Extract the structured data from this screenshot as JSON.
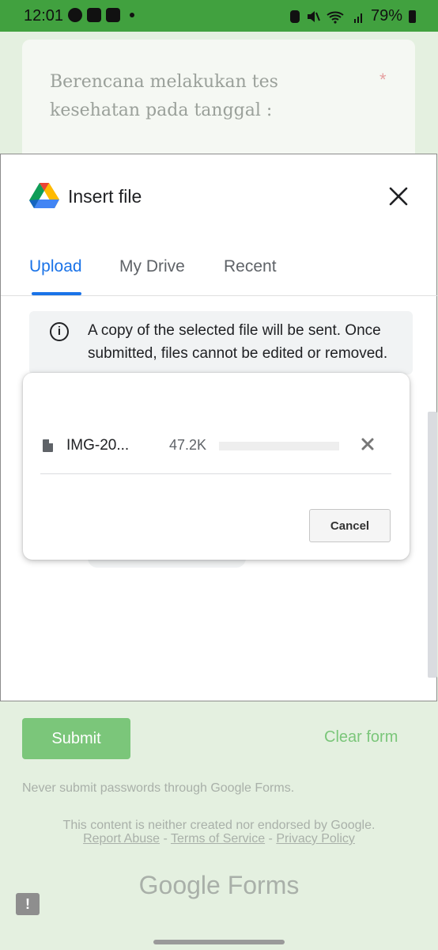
{
  "status_bar": {
    "time": "12:01",
    "battery": "79%",
    "icons": [
      "messenger-icon",
      "gallery-icon",
      "calendar-icon",
      "notification-dot-icon",
      "battery-saver-icon",
      "mute-icon",
      "wifi-icon",
      "signal-icon",
      "battery-icon"
    ]
  },
  "form": {
    "question": "Berencana melakukan tes kesehatan pada tanggal :",
    "required_mark": "*",
    "submit_label": "Submit",
    "clear_label": "Clear form",
    "password_warning": "Never submit passwords through Google Forms.",
    "notice": "This content is neither created nor endorsed by Google.",
    "links": {
      "report_abuse": "Report Abuse",
      "terms": "Terms of Service",
      "privacy": "Privacy Policy",
      "separator": " - "
    },
    "logo": "Google Forms",
    "feedback_glyph": "!"
  },
  "dialog": {
    "title": "Insert file",
    "tabs": [
      {
        "label": "Upload",
        "active": true
      },
      {
        "label": "My Drive",
        "active": false
      },
      {
        "label": "Recent",
        "active": false
      }
    ],
    "info_text": "A copy of the selected file will be sent. Once submitted, files cannot be edited or removed."
  },
  "upload": {
    "file_name": "IMG-20...",
    "file_size": "47.2K",
    "progress": 0.0,
    "cancel_label": "Cancel"
  },
  "colors": {
    "status_bar": "#41a13f",
    "accent_blue": "#1a73e8",
    "form_green": "#7bc67a"
  }
}
